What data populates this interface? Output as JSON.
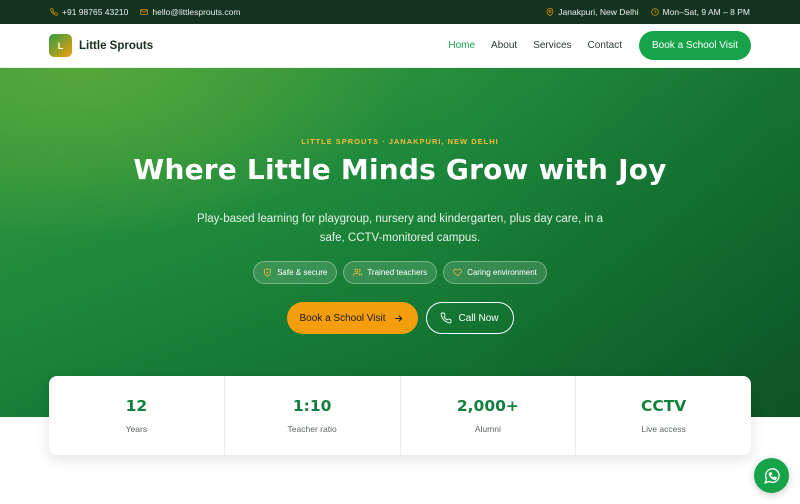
{
  "topbar": {
    "phone": "+91 98765 43210",
    "email": "hello@littlesprouts.com",
    "location": "Janakpuri, New Delhi",
    "hours": "Mon–Sat, 9 AM – 8 PM"
  },
  "nav": {
    "logo_letter": "L",
    "brand": "Little Sprouts",
    "links": [
      "Home",
      "About",
      "Services",
      "Contact"
    ],
    "active": "Home",
    "cta": "Book a School Visit"
  },
  "hero": {
    "eyebrow": "LITTLE SPROUTS · JANAKPURI, NEW DELHI",
    "title": "Where Little Minds Grow with Joy",
    "subtitle": "Play-based learning for playgroup, nursery and kindergarten, plus day care, in a safe, CCTV-monitored campus.",
    "pills": [
      {
        "icon": "shield-icon",
        "label": "Safe & secure"
      },
      {
        "icon": "users-icon",
        "label": "Trained teachers"
      },
      {
        "icon": "heart-icon",
        "label": "Caring environment"
      }
    ],
    "primary_cta": "Book a School Visit",
    "secondary_cta": "Call Now"
  },
  "stats": [
    {
      "value": "12",
      "label": "Years"
    },
    {
      "value": "1:10",
      "label": "Teacher ratio"
    },
    {
      "value": "2,000+",
      "label": "Alumni"
    },
    {
      "value": "CCTV",
      "label": "Live access"
    }
  ],
  "colors": {
    "primary": "#16a34a",
    "accent": "#f59e0b",
    "topbar": "#14331e"
  }
}
